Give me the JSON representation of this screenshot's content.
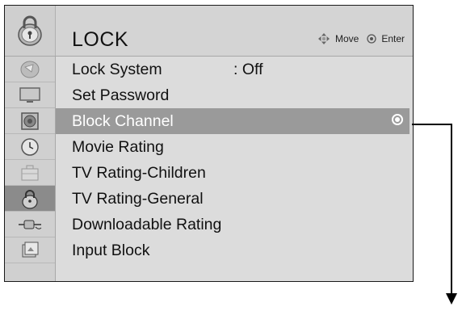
{
  "header": {
    "title": "LOCK",
    "hints": [
      {
        "label": "Move",
        "icon": "dpad-arrows-icon"
      },
      {
        "label": "Enter",
        "icon": "enter-circle-icon"
      }
    ]
  },
  "sidebar": {
    "icons": [
      {
        "name": "picture-icon"
      },
      {
        "name": "display-icon"
      },
      {
        "name": "speaker-icon"
      },
      {
        "name": "clock-icon"
      },
      {
        "name": "briefcase-icon"
      },
      {
        "name": "lock-icon",
        "active": true
      },
      {
        "name": "input-plug-icon"
      },
      {
        "name": "media-icon"
      }
    ]
  },
  "menu": {
    "items": [
      {
        "label": "Lock System",
        "value": ": Off"
      },
      {
        "label": "Set Password"
      },
      {
        "label": "Block Channel",
        "selected": true
      },
      {
        "label": "Movie Rating"
      },
      {
        "label": "TV Rating-Children"
      },
      {
        "label": "TV Rating-General"
      },
      {
        "label": "Downloadable Rating"
      },
      {
        "label": "Input Block"
      }
    ]
  },
  "colors": {
    "panel_bg": "#dcdcdc",
    "selected_bg": "#9a9a9a",
    "border": "#1a1a1a"
  }
}
